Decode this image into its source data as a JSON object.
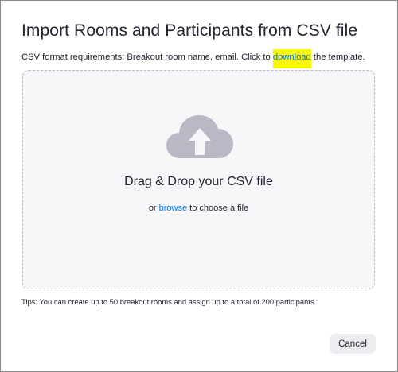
{
  "dialog": {
    "title": "Import Rooms and Participants from CSV file",
    "requirements": {
      "prefix": "CSV format requirements: Breakout room name, email. Click to ",
      "link": "download",
      "suffix": " the template."
    },
    "dropzone": {
      "icon": "cloud-upload-icon",
      "title": "Drag & Drop your CSV file",
      "sub_prefix": "or ",
      "sub_link": "browse",
      "sub_suffix": " to choose a file"
    },
    "tips": "Tips: You can create up to 50 breakout rooms and assign up to a total of 200 participants.",
    "cancel_label": "Cancel"
  },
  "colors": {
    "link": "#0e71eb",
    "highlight": "#f8f800",
    "icon": "#b9b9c6",
    "dropzone_bg": "#f7f7fa"
  }
}
